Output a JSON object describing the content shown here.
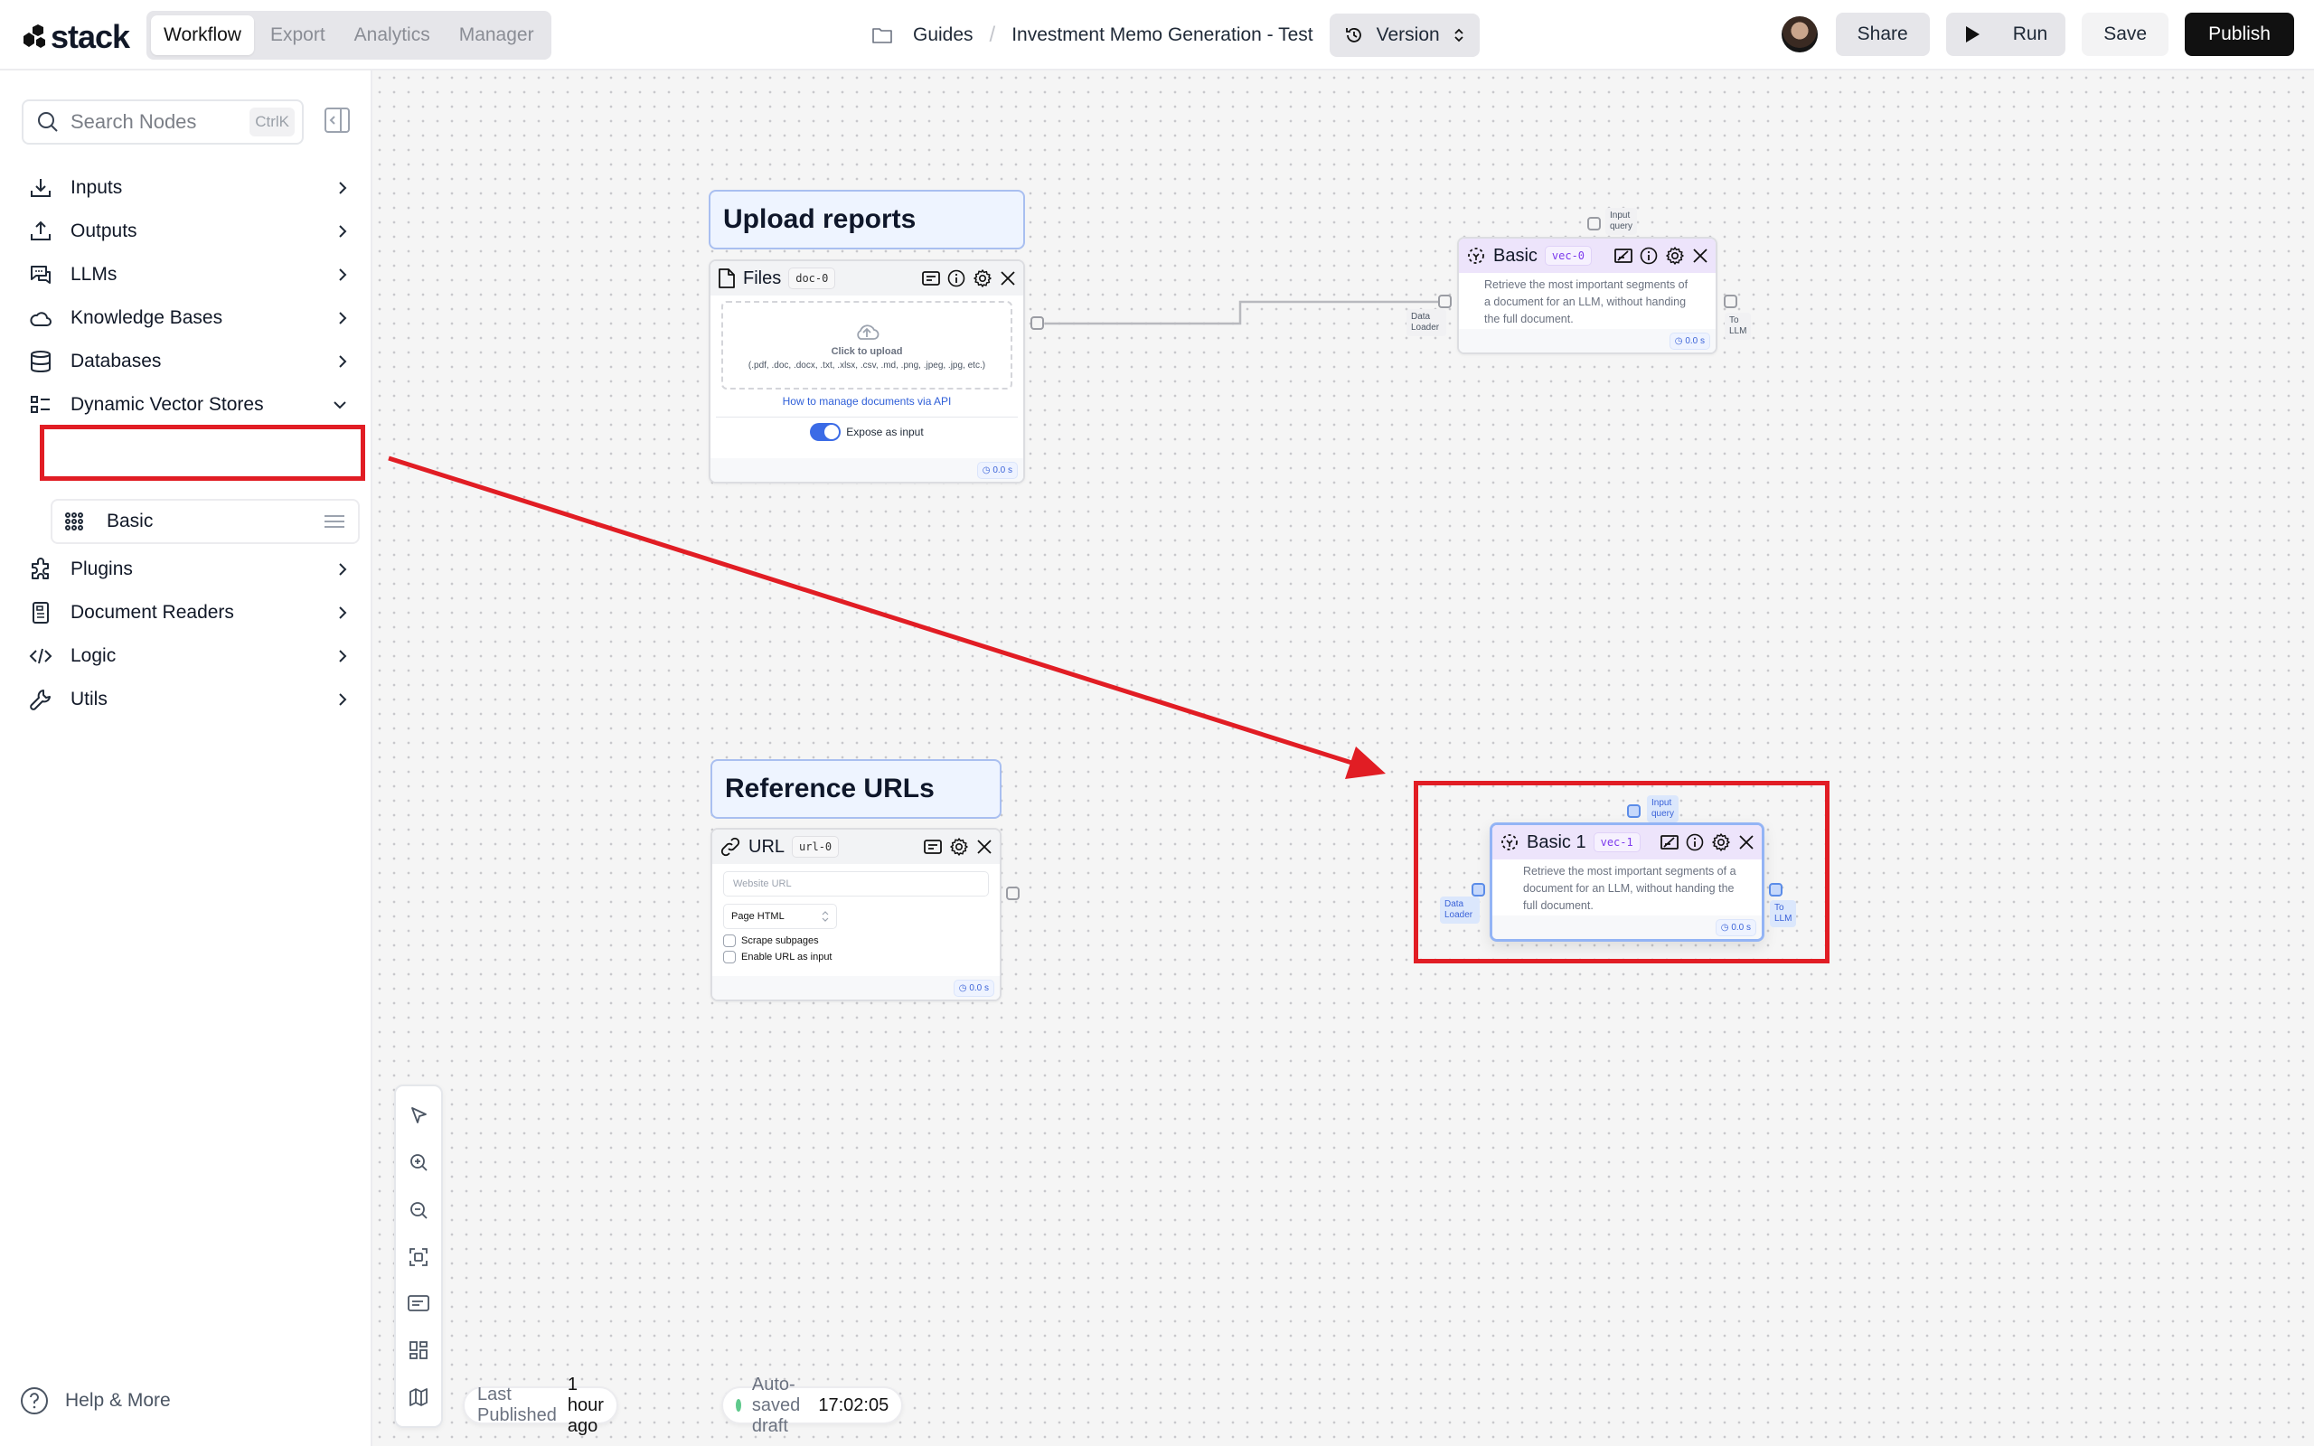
{
  "header": {
    "logo": "stack",
    "tabs": [
      {
        "label": "Workflow",
        "active": true
      },
      {
        "label": "Export",
        "active": false
      },
      {
        "label": "Analytics",
        "active": false
      },
      {
        "label": "Manager",
        "active": false
      }
    ],
    "breadcrumb": {
      "folder": "Guides",
      "separator": "/",
      "project": "Investment Memo Generation - Test"
    },
    "version_label": "Version",
    "buttons": {
      "share": "Share",
      "run": "Run",
      "save": "Save",
      "publish": "Publish"
    }
  },
  "sidebar": {
    "search": {
      "placeholder": "Search Nodes",
      "shortcut": "CtrlK"
    },
    "items": [
      {
        "label": "Inputs",
        "icon": "download-icon",
        "expanded": false
      },
      {
        "label": "Outputs",
        "icon": "upload-icon",
        "expanded": false
      },
      {
        "label": "LLMs",
        "icon": "chat-icon",
        "expanded": false
      },
      {
        "label": "Knowledge Bases",
        "icon": "cloud-icon",
        "expanded": false
      },
      {
        "label": "Databases",
        "icon": "database-icon",
        "expanded": false
      },
      {
        "label": "Dynamic Vector Stores",
        "icon": "vector-store-icon",
        "expanded": true
      },
      {
        "label": "Plugins",
        "icon": "puzzle-icon",
        "expanded": false
      },
      {
        "label": "Document Readers",
        "icon": "document-icon",
        "expanded": false
      },
      {
        "label": "Logic",
        "icon": "code-icon",
        "expanded": false
      },
      {
        "label": "Utils",
        "icon": "wrench-icon",
        "expanded": false
      }
    ],
    "sub_item": {
      "label": "Basic",
      "icon": "grid-dots-icon"
    },
    "help": "Help & More"
  },
  "canvas": {
    "groups": [
      {
        "title": "Upload reports"
      },
      {
        "title": "Reference URLs"
      }
    ],
    "files_node": {
      "title": "Files",
      "tag": "doc-0",
      "upload_label": "Click to upload",
      "upload_types": "(.pdf, .doc, .docx, .txt, .xlsx, .csv, .md, .png, .jpeg, .jpg, etc.)",
      "api_link": "How to manage documents via API",
      "expose_label": "Expose as input",
      "expose_on": true,
      "timer": "0.0 s"
    },
    "url_node": {
      "title": "URL",
      "tag": "url-0",
      "url_placeholder": "Website URL",
      "mode": "Page HTML",
      "scrape_label": "Scrape subpages",
      "scrape_checked": false,
      "enable_label": "Enable URL as input",
      "enable_checked": false,
      "timer": "0.0 s"
    },
    "vec_node_0": {
      "title": "Basic",
      "tag": "vec-0",
      "description": "Retrieve the most important segments of a document for an LLM, without handing the full document.",
      "timer": "0.0 s",
      "handles": {
        "top": "Input query",
        "left": "Data Loader",
        "right": "To LLM"
      }
    },
    "vec_node_1": {
      "title": "Basic 1",
      "tag": "vec-1",
      "description": "Retrieve the most important segments of a document for an LLM, without handing the full document.",
      "timer": "0.0 s",
      "handles": {
        "top": "Input query",
        "left": "Data Loader",
        "right": "To LLM"
      }
    }
  },
  "status": {
    "published_label": "Last Published",
    "published_value": "1 hour ago",
    "autosave_label": "Auto-saved draft",
    "autosave_value": "17:02:05"
  },
  "annotation_color": "#e11d24",
  "accent_color": "#3b6be6"
}
